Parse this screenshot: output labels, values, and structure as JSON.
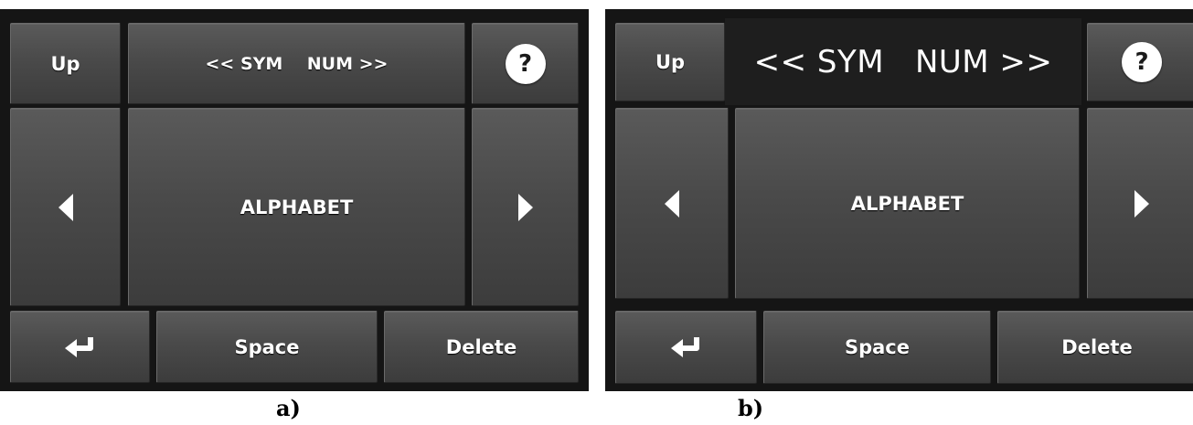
{
  "panels": [
    {
      "up_label": "Up",
      "mode_label": "<< SYM    NUM >>",
      "help_label": "?",
      "center_label": "ALPHABET",
      "space_label": "Space",
      "delete_label": "Delete",
      "caption": "a)"
    },
    {
      "up_label": "Up",
      "mode_label": "<< SYM   NUM >>",
      "help_label": "?",
      "center_label": "ALPHABET",
      "space_label": "Space",
      "delete_label": "Delete",
      "caption": "b)"
    }
  ],
  "icons": {
    "left": "left-arrow-icon",
    "right": "right-arrow-icon",
    "enter": "enter-return-icon",
    "help": "help-icon"
  },
  "colors": {
    "key_top": "#5a5a5a",
    "key_bottom": "#3c3c3c",
    "background": "#151515",
    "text": "#ffffff"
  }
}
